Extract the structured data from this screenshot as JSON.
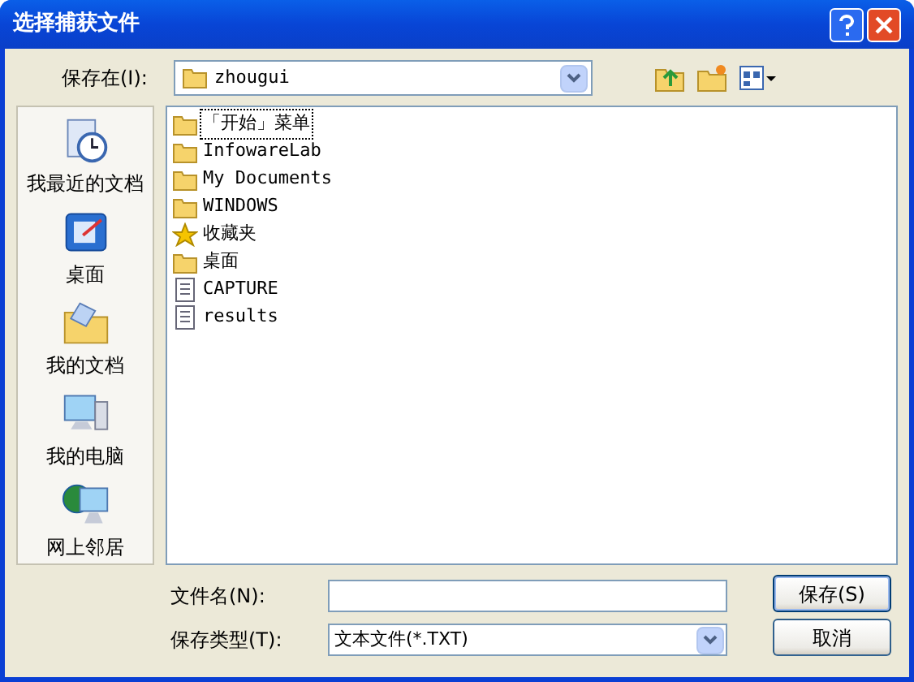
{
  "window": {
    "title": "选择捕获文件"
  },
  "save_in": {
    "label": "保存在(I):",
    "value": "zhougui"
  },
  "places": [
    {
      "label": "我最近的文档",
      "kind": "recent"
    },
    {
      "label": "桌面",
      "kind": "desktop"
    },
    {
      "label": "我的文档",
      "kind": "documents"
    },
    {
      "label": "我的电脑",
      "kind": "computer"
    },
    {
      "label": "网上邻居",
      "kind": "network"
    }
  ],
  "files": [
    {
      "name": "「开始」菜单",
      "kind": "folder",
      "focused": true
    },
    {
      "name": "InfowareLab",
      "kind": "folder",
      "focused": false
    },
    {
      "name": "My Documents",
      "kind": "folder",
      "focused": false
    },
    {
      "name": "WINDOWS",
      "kind": "folder",
      "focused": false
    },
    {
      "name": "收藏夹",
      "kind": "favorites",
      "focused": false
    },
    {
      "name": "桌面",
      "kind": "folder",
      "focused": false
    },
    {
      "name": "CAPTURE",
      "kind": "text",
      "focused": false
    },
    {
      "name": "results",
      "kind": "text",
      "focused": false
    }
  ],
  "file_name": {
    "label": "文件名(N):"
  },
  "file_type": {
    "label": "保存类型(T):",
    "value": "文本文件(*.TXT)"
  },
  "buttons": [
    {
      "label": "保存(S)",
      "default": true
    },
    {
      "label": "取消",
      "default": false
    }
  ]
}
